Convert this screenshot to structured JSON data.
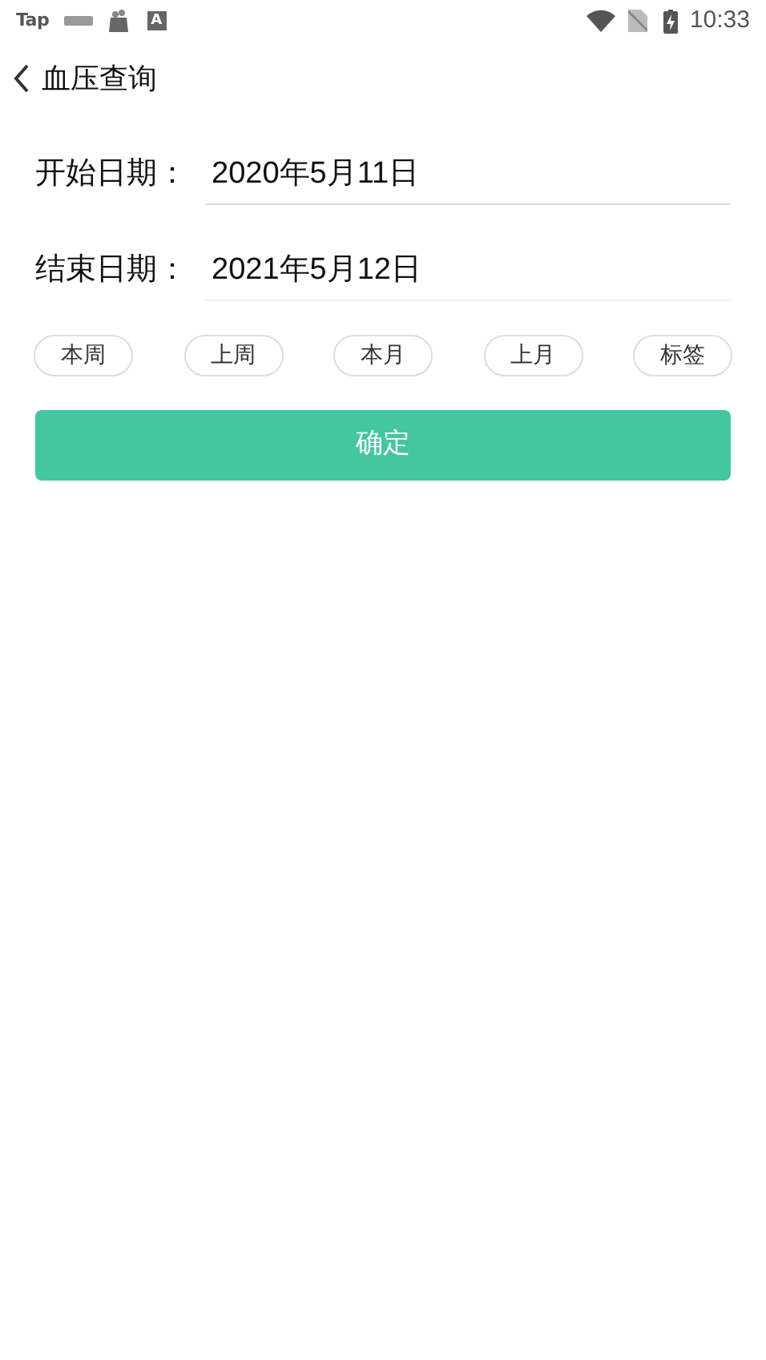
{
  "status_bar": {
    "app_label": "Tap",
    "store_badge": "A",
    "time": "10:33"
  },
  "header": {
    "title": "血压查询"
  },
  "fields": [
    {
      "label": "开始日期：",
      "value": "2020年5月11日"
    },
    {
      "label": "结束日期：",
      "value": "2021年5月12日"
    }
  ],
  "quick_ranges": [
    "本周",
    "上周",
    "本月",
    "上月",
    "标签"
  ],
  "confirm_button": "确定"
}
